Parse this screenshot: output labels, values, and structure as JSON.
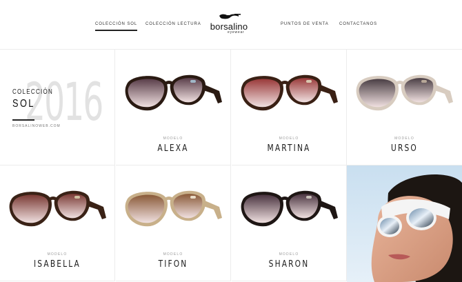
{
  "nav": {
    "items": [
      {
        "label": "COLECCIÓN SOL",
        "active": true
      },
      {
        "label": "COLECCIÓN LECTURA",
        "active": false
      },
      {
        "label": "PUNTOS DE VENTA",
        "active": false
      },
      {
        "label": "CONTACTANOS",
        "active": false
      }
    ]
  },
  "logo": {
    "word": "borsalino",
    "sub": "eyewear"
  },
  "intro": {
    "year": "2016",
    "line1": "COLECCIÓN",
    "line2": "SOL",
    "site": "BORSALINOWEB.COM"
  },
  "products": [
    {
      "modelo": "MODELO",
      "name": "ALEXA",
      "frame": "#2a1a12",
      "lens": "#5a3e4a",
      "accent": "#a0b8c8"
    },
    {
      "modelo": "MODELO",
      "name": "MARTINA",
      "frame": "#3a2014",
      "lens": "#9a3a3a",
      "accent": "#d8c8b0"
    },
    {
      "modelo": "MODELO",
      "name": "URSO",
      "frame": "#d8ccc0",
      "lens": "#4a3e44",
      "accent": "#b8a898"
    },
    {
      "modelo": "MODELO",
      "name": "ISABELLA",
      "frame": "#3a2216",
      "lens": "#7a3a34",
      "accent": "#d0c0a0"
    },
    {
      "modelo": "MODELO",
      "name": "TIFON",
      "frame": "#c8b08a",
      "lens": "#8a5a38",
      "accent": "#e8dcc8"
    },
    {
      "modelo": "MODELO",
      "name": "SHARON",
      "frame": "#1e1614",
      "lens": "#4a3440",
      "accent": "#c8c0b8"
    }
  ]
}
